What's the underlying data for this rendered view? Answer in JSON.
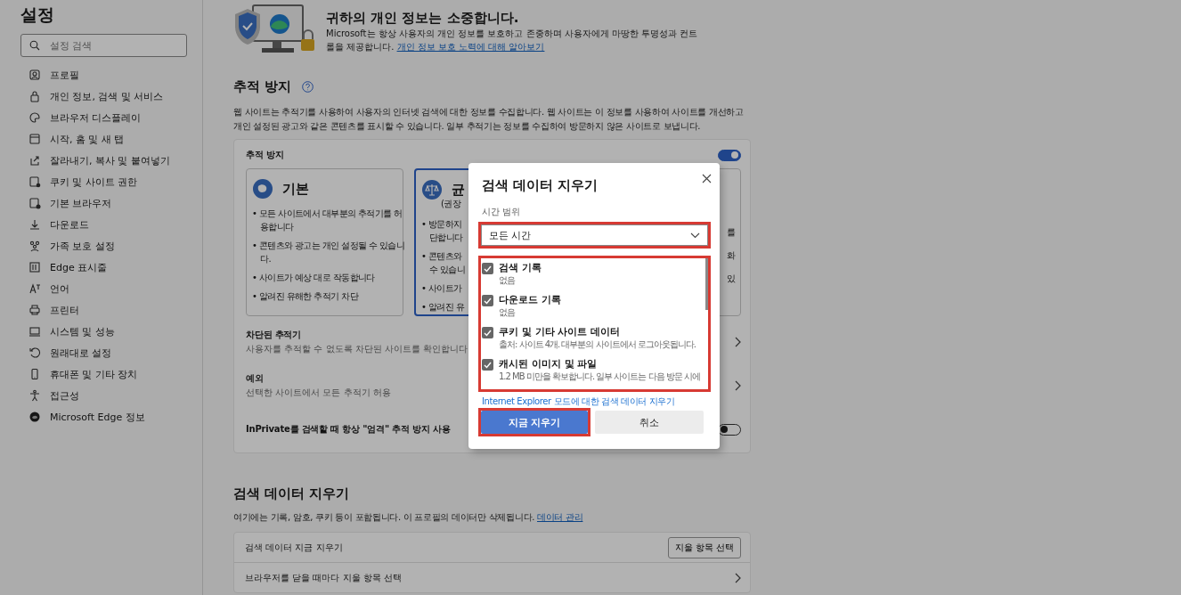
{
  "sidebar": {
    "title": "설정",
    "search": {
      "placeholder": "설정 검색"
    },
    "items": [
      "프로필",
      "개인 정보, 검색 및 서비스",
      "브라우저 디스플레이",
      "시작, 홈 및 새 탭",
      "잘라내기, 복사 및 붙여넣기",
      "쿠키 및 사이트 권한",
      "기본 브라우저",
      "다운로드",
      "가족 보호 설정",
      "Edge 표시줄",
      "언어",
      "프린터",
      "시스템 및 성능",
      "원래대로 설정",
      "휴대폰 및 기타 장치",
      "접근성",
      "Microsoft Edge 정보"
    ]
  },
  "privacy_banner": {
    "title": "귀하의 개인 정보는 소중합니다.",
    "text": "Microsoft는 항상 사용자의 개인 정보를 보호하고 존중하며 사용자에게 마땅한 투명성과 컨트롤을 제공합니다.",
    "link": "개인 정보 보호 노력에 대해 알아보기"
  },
  "tracking": {
    "heading": "추적 방지",
    "description": "웹 사이트는 추적기를 사용하여 사용자의 인터넷 검색에 대한 정보를 수집합니다. 웹 사이트는 이 정보를 사용하여 사이트를 개선하고 개인 설정된 광고와 같은 콘텐츠를 표시할 수 있습니다. 일부 추적기는 정보를 수집하여 방문하지 않은 사이트로 보냅니다.",
    "card_title": "추적 방지",
    "on": true,
    "levels": [
      {
        "title": "기본",
        "bullets": [
          "• 모든 사이트에서 대부분의 추적기를 허용합니다",
          "• 콘텐츠와 광고는 개인 설정될 수 있습니다.",
          "• 사이트가 예상 대로 작동합니다",
          "• 알려진 유해한 추적기 차단"
        ],
        "selected": false
      },
      {
        "title": "균",
        "subtitle": "(권장",
        "bullets": [
          "• 방문하지\n단합니다",
          "• 콘텐츠와\n수 있습니",
          "• 사이트가",
          "• 알려진 유"
        ],
        "selected": true
      },
      {
        "bullets": [
          "를",
          "화",
          "있"
        ],
        "selected": false
      }
    ],
    "rows": [
      {
        "kind": "link",
        "title": "차단된 추적기",
        "description": "사용자를 추적할 수 없도록 차단된 사이트를 확인합니다"
      },
      {
        "kind": "link",
        "title": "예외",
        "description": "선택한 사이트에서 모든 추적기 허용"
      },
      {
        "kind": "toggle",
        "title": "InPrivate를 검색할 때 항상 \"엄격\" 추적 방지 사용",
        "on": false
      }
    ]
  },
  "clear_data": {
    "heading": "검색 데이터 지우기",
    "description": "여기에는 기록, 암호, 쿠키 등이 포함됩니다. 이 프로필의 데이터만 삭제됩니다.",
    "link": "데이터 관리",
    "rows": [
      {
        "kind": "button",
        "title": "검색 데이터 지금 지우기",
        "button": "지울 항목 선택"
      },
      {
        "kind": "link",
        "title": "브라우저를 닫을 때마다 지울 항목 선택"
      }
    ]
  },
  "dialog": {
    "title": "검색 데이터 지우기",
    "time_range": {
      "label": "시간 범위",
      "value": "모든 시간",
      "highlighted": true
    },
    "options_highlighted": true,
    "options": [
      {
        "label": "검색 기록",
        "detail": "없음",
        "checked": true
      },
      {
        "label": "다운로드 기록",
        "detail": "없음",
        "checked": true
      },
      {
        "label": "쿠키 및 기타 사이트 데이터",
        "detail": "출처: 사이트 4개. 대부분의 사이트에서 로그아웃됩니다.",
        "checked": true
      },
      {
        "label": "캐시된 이미지 및 파일",
        "detail": "1.2 MB 미만을 확보합니다. 일부 사이트는 다음 방문 시에",
        "checked": true
      }
    ],
    "link": "Internet Explorer 모드에 대한 검색 데이터 지우기",
    "buttons": [
      {
        "kind": "primary",
        "label": "지금 지우기",
        "highlighted": true
      },
      {
        "kind": "secondary",
        "label": "취소",
        "highlighted": false
      }
    ]
  }
}
